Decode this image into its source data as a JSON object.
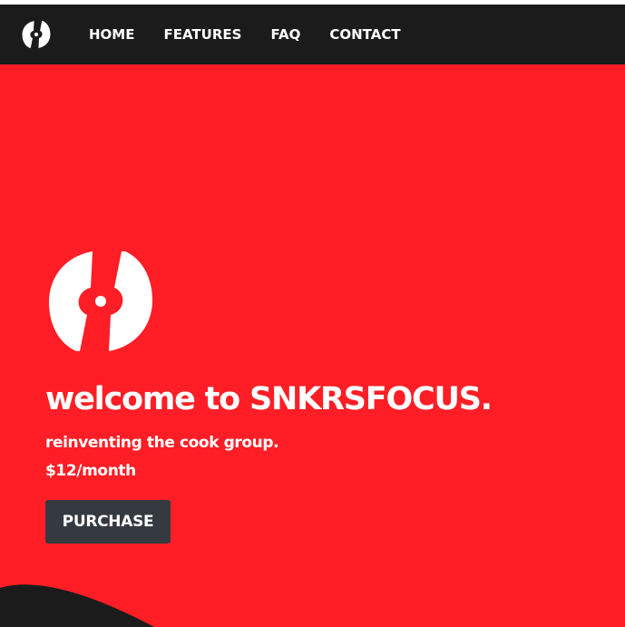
{
  "nav": {
    "logo_icon": "snkrsfocus-logo-icon",
    "items": [
      {
        "label": "HOME"
      },
      {
        "label": "FEATURES"
      },
      {
        "label": "FAQ"
      },
      {
        "label": "CONTACT"
      }
    ]
  },
  "hero": {
    "logo_icon": "snkrsfocus-logo-icon",
    "title": "welcome to SNKRSFOCUS.",
    "subtitle": "reinventing the cook group.",
    "price": "$12/month",
    "purchase_label": "PURCHASE"
  },
  "colors": {
    "brand_red": "#ff1e26",
    "nav_background": "#1b1b1b",
    "button_background": "#343a40",
    "text": "#ffffff"
  }
}
